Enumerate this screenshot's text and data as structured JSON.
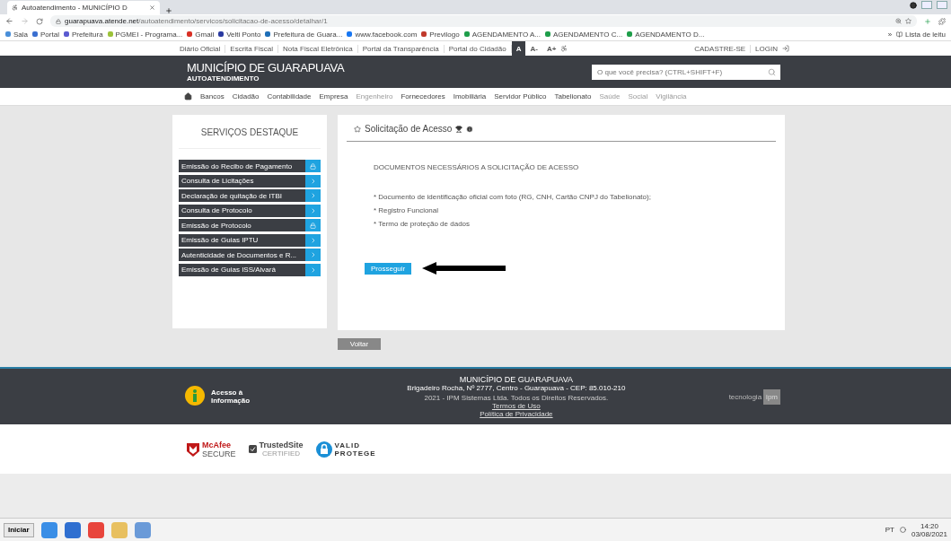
{
  "browser": {
    "tab_title": "Autoatendimento - MUNICÍPIO D",
    "url_host": "guarapuava.atende.net",
    "url_path": "/autoatendimento/servicos/solicitacao-de-acesso/detalhar/1",
    "bookmarks": [
      {
        "label": "Sala",
        "color": "#4a8fd9"
      },
      {
        "label": "Portal",
        "color": "#3a6fd0"
      },
      {
        "label": "Prefeitura",
        "color": "#5a5ad0"
      },
      {
        "label": "PGMEI - Programa...",
        "color": "#9cc23a"
      },
      {
        "label": "Gmail",
        "color": "#d93025"
      },
      {
        "label": "Velti Ponto",
        "color": "#2a3aa0"
      },
      {
        "label": "Prefeitura de Guara...",
        "color": "#1e6fb8"
      },
      {
        "label": "www.facebook.com",
        "color": "#1877f2"
      },
      {
        "label": "Previlogo",
        "color": "#c0392b"
      },
      {
        "label": "AGENDAMENTO A...",
        "color": "#1e9e4a"
      },
      {
        "label": "AGENDAMENTO C...",
        "color": "#1e9e4a"
      },
      {
        "label": "AGENDAMENTO D...",
        "color": "#1e9e4a"
      }
    ],
    "more": "»",
    "reading_list": "Lista de leitu"
  },
  "site": {
    "top_links": [
      "Diário Oficial",
      "Escrita Fiscal",
      "Nota Fiscal Eletrônica",
      "Portal da Transparência",
      "Portal do Cidadão"
    ],
    "font_controls": [
      {
        "label": "A",
        "selected": true
      },
      {
        "label": "A-",
        "selected": false
      },
      {
        "label": "A+",
        "selected": false
      }
    ],
    "account_links": [
      "CADASTRE-SE",
      "LOGIN"
    ],
    "title": "MUNICÍPIO DE GUARAPUAVA",
    "subtitle": "AUTOATENDIMENTO",
    "search_placeholder": "O que você precisa? (CTRL+SHIFT+F)",
    "nav": [
      {
        "label": "Bancos",
        "disabled": false
      },
      {
        "label": "Cidadão",
        "disabled": false
      },
      {
        "label": "Contabilidade",
        "disabled": false
      },
      {
        "label": "Empresa",
        "disabled": false
      },
      {
        "label": "Engenheiro",
        "disabled": true
      },
      {
        "label": "Fornecedores",
        "disabled": false
      },
      {
        "label": "Imobiliária",
        "disabled": false
      },
      {
        "label": "Servidor Público",
        "disabled": false
      },
      {
        "label": "Tabelionato",
        "disabled": false
      },
      {
        "label": "Saúde",
        "disabled": true
      },
      {
        "label": "Social",
        "disabled": true
      },
      {
        "label": "Vigilância",
        "disabled": true
      }
    ]
  },
  "sidebar": {
    "title": "SERVIÇOS DESTAQUE",
    "items": [
      {
        "label": "Emissão do Recibo de Pagamento",
        "kind": "lock"
      },
      {
        "label": "Consulta de Licitações",
        "kind": "arrow"
      },
      {
        "label": "Declaração de quitação de ITBI",
        "kind": "arrow"
      },
      {
        "label": "Consulta de Protocolo",
        "kind": "arrow"
      },
      {
        "label": "Emissão de Protocolo",
        "kind": "lock"
      },
      {
        "label": "Emissão de Guias IPTU",
        "kind": "arrow"
      },
      {
        "label": "Autenticidade de Documentos e R...",
        "kind": "arrow"
      },
      {
        "label": "Emissão de Guias ISS/Alvará",
        "kind": "arrow"
      }
    ]
  },
  "content": {
    "title": "Solicitação de Acesso",
    "heading": "DOCUMENTOS NECESSÁRIOS A SOLICITAÇÃO DE ACESSO",
    "items": [
      "* Documento de identificação oficial com foto (RG, CNH, Cartão CNPJ do Tabelionato);",
      "* Registro Funcional",
      "* Termo de proteção de dados"
    ],
    "button": "Prosseguir",
    "back": "Voltar"
  },
  "footer": {
    "access_lines": [
      "Acesso à",
      "Informação"
    ],
    "org": "MUNICÍPIO DE GUARAPUAVA",
    "address": "Brigadeiro Rocha, Nº 2777, Centro - Guarapuava - CEP: 85.010-210",
    "copyright": "2021 - IPM Sistemas Ltda. Todos os Direitos Reservados.",
    "links": [
      "Termos de Uso",
      "Política de Privacidade"
    ],
    "tech": "tecnologia",
    "tech_logo": "ipm"
  },
  "seals": {
    "mcafee": [
      "McAfee",
      "SECURE"
    ],
    "trusted": [
      "TrustedSite",
      "CERTIFIED"
    ],
    "valid": [
      "VALID",
      "PROTEGE"
    ]
  },
  "taskbar": {
    "start": "Iniciar",
    "lang": "PT",
    "time": "14:20",
    "date": "03/08/2021"
  }
}
